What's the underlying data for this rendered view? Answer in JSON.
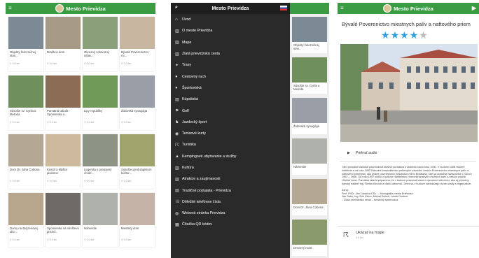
{
  "app_title": "Mesto Prievidza",
  "distance_label": "0,0 km",
  "colors": {
    "brand_green": "#3a9b43",
    "drawer_bg": "#2a2a2a",
    "star": "#2e9fe0"
  },
  "grid_items": [
    {
      "title": "Objekty železničnej stan...",
      "thumb": "#7c8a96"
    },
    {
      "title": "Draškov dom",
      "thumb": "#a89b86"
    },
    {
      "title": "Okresný zdravotný ústav...",
      "thumb": "#8aa07a"
    },
    {
      "title": "Bývalé Poverenictvo mi...",
      "thumb": "#c9b6a0"
    },
    {
      "title": "Súsošie sv. Cyrila a Metoda",
      "thumb": "#6f8f5d"
    },
    {
      "title": "Pamätná tabuľa - Spomienka n...",
      "thumb": "#8b6d55"
    },
    {
      "title": "Lipy republiky",
      "thumb": "#6f9a58"
    },
    {
      "title": "Židovská synagóga",
      "thumb": "#9a9ea6"
    },
    {
      "title": "Dom Dr. Jána Čobona",
      "thumb": "#b4a894"
    },
    {
      "title": "Kostol a kláštor piaristov",
      "thumb": "#cdb99c"
    },
    {
      "title": "Legenda o prepojení chodí...",
      "thumb": "#8e9485"
    },
    {
      "title": "Súsošie pred ságistom kúštor...",
      "thumb": "#a0a56e"
    },
    {
      "title": "Domy na Mojzesovej ulici...",
      "thumb": "#b7a58c"
    },
    {
      "title": "Spomienka na návštevu prezid...",
      "thumb": "#6d6a68"
    },
    {
      "title": "Námestie",
      "thumb": "#aeb2ab"
    },
    {
      "title": "Mestský dom",
      "thumb": "#c4b3a6"
    }
  ],
  "menu_items": [
    {
      "icon": "home-icon",
      "glyph": "⌂",
      "label": "Úvod"
    },
    {
      "icon": "building-icon",
      "glyph": "▥",
      "label": "O meste Prievidza"
    },
    {
      "icon": "building-icon",
      "glyph": "▥",
      "label": "Mapa"
    },
    {
      "icon": "building-icon",
      "glyph": "▥",
      "label": "Zlatá prievidzská cesta"
    },
    {
      "icon": "sign-icon",
      "glyph": "✦",
      "label": "Trasy"
    },
    {
      "icon": "person-icon",
      "glyph": "●",
      "label": "Cestovný ruch"
    },
    {
      "icon": "person-icon",
      "glyph": "●",
      "label": "Športoviská"
    },
    {
      "icon": "building-icon",
      "glyph": "▥",
      "label": "Kúpaliská"
    },
    {
      "icon": "golf-icon",
      "glyph": "⚑",
      "label": "Golf"
    },
    {
      "icon": "horse-icon",
      "glyph": "♞",
      "label": "Jazdecký šport"
    },
    {
      "icon": "tennis-icon",
      "glyph": "◉",
      "label": "Tenisové kurty"
    },
    {
      "icon": "walk-icon",
      "glyph": "☈",
      "label": "Turistika"
    },
    {
      "icon": "tent-icon",
      "glyph": "▲",
      "label": "Kempingové ubytovanie a služby"
    },
    {
      "icon": "building-icon",
      "glyph": "▥",
      "label": "Kultúra"
    },
    {
      "icon": "building-icon",
      "glyph": "▥",
      "label": "Atrakcie a zaujímavosti"
    },
    {
      "icon": "building-icon",
      "glyph": "▥",
      "label": "Tradičné podujatia - Prievidza"
    },
    {
      "icon": "phone-icon",
      "glyph": "☏",
      "label": "Dôležité telefónne čísla"
    },
    {
      "icon": "globe-icon",
      "glyph": "◍",
      "label": "Webová stránka Prievidza"
    },
    {
      "icon": "qr-icon",
      "glyph": "▦",
      "label": "Čítačka QR kódov"
    }
  ],
  "behind_items": [
    {
      "title": "Objekty železničnej stan...",
      "thumb": "#7c8a96"
    },
    {
      "title": "Súsošie sv. Cyrila a Metoda",
      "thumb": "#6f8f5d"
    },
    {
      "title": "Židovská synagóga",
      "thumb": "#9a9ea6"
    },
    {
      "title": "Námestie",
      "thumb": "#aeb2ab"
    },
    {
      "title": "Dom Dr. Jána Čobona",
      "thumb": "#b4a894"
    },
    {
      "title": "Drevený most",
      "thumb": "#8a9a6c"
    }
  ],
  "detail": {
    "title": "Bývalé Poverenictvo miestnych palív a naftového priem",
    "rating": 4,
    "max_rating": 5,
    "audio_label": "Prehrať audio",
    "body": "Táto pôvodne klasická poschodová stavba pochádza z obdobia okolo roku 1930. V budove sídlili viaceré inštitúcie a od roku 1952 Národne hospodárstvo palivových závodov, neskôr Poverenictvo miestnych palív a naftového priemyslu, ako jediné poverenictvo pôsobiace mimo Bratislavy, kde sa dosiahla ťažba uhlia v rokoch 1952 – 1956. Od roku 1957 sídlilo v budove riaditeľstvo Hornonitrianskych uhoľných baní a neskôr podnik Uhoľné bane. Pamätná tabuľa pripomína, že v budove pracovali viacerí významní odborníci, ako aj pôvodný banský riaditeľ Ing. Štefan Klinčok a ďalší odborníci. Dnes sa v budove nachádzajú rôzne úrady a organizácie.",
    "sources": "Zdroj:\nProf. PhDr. Ján Lukačka CSc. – Monografia mesta Prievidza.\nJán Sabo, Ing. Erik Kišon, Michal Dobeš, Lukáš Grešner\n– Zlatá prievidzská cesta – turistický sprievodca",
    "map_label": "Ukázať na mape"
  }
}
